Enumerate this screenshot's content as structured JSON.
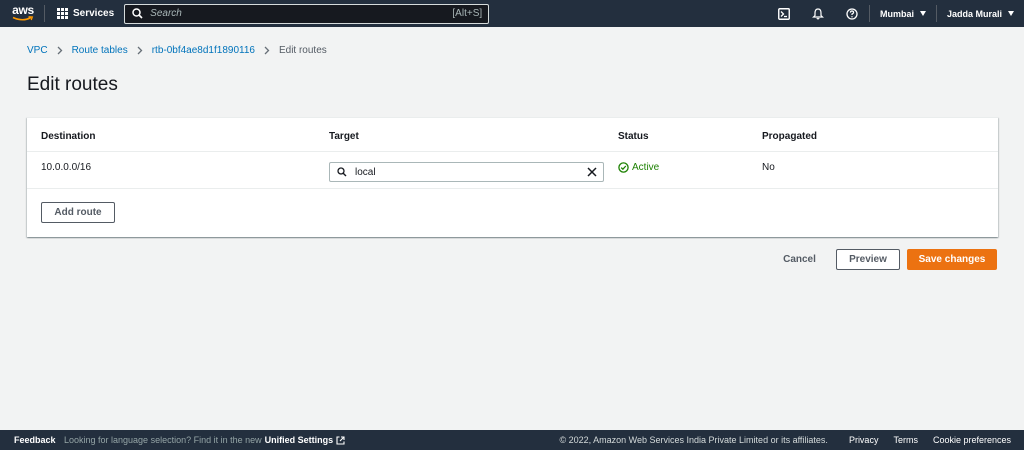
{
  "topnav": {
    "logo_text": "aws",
    "services_label": "Services",
    "search_placeholder": "Search",
    "search_shortcut": "[Alt+S]",
    "region_label": "Mumbai",
    "account_label": "Jadda Murali",
    "icons": [
      "cloudshell-icon",
      "bell-icon",
      "help-icon"
    ]
  },
  "breadcrumb": {
    "items": [
      "VPC",
      "Route tables",
      "rtb-0bf4ae8d1f1890116"
    ],
    "current": "Edit routes"
  },
  "page": {
    "title": "Edit routes"
  },
  "routes_table": {
    "columns": {
      "destination": "Destination",
      "target": "Target",
      "status": "Status",
      "propagated": "Propagated"
    },
    "rows": [
      {
        "destination": "10.0.0.0/16",
        "target": "local",
        "status": "Active",
        "propagated": "No"
      }
    ],
    "add_route_label": "Add route"
  },
  "actions": {
    "cancel_label": "Cancel",
    "preview_label": "Preview",
    "save_label": "Save changes"
  },
  "footer": {
    "feedback": "Feedback",
    "language_note": "Looking for language selection? Find it in the new",
    "unified_settings": "Unified Settings",
    "copyright": "© 2022, Amazon Web Services India Private Limited or its affiliates.",
    "privacy": "Privacy",
    "terms": "Terms",
    "cookie_preferences": "Cookie preferences"
  },
  "colors": {
    "nav_bg": "#232f3e",
    "link": "#0073bb",
    "primary_button": "#ec7211",
    "success": "#1d8102",
    "page_bg": "#f2f3f3"
  }
}
